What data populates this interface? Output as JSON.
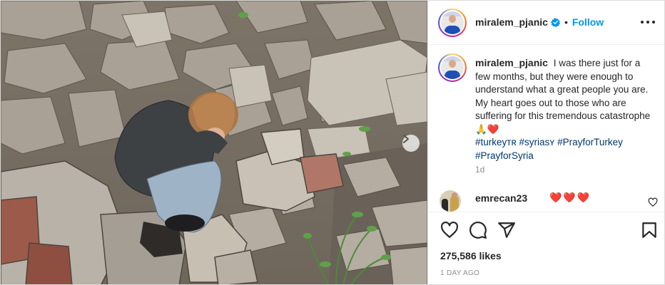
{
  "post": {
    "image_alt": "Child sitting in rubble covering his face",
    "next_icon": "chevron-right-icon"
  },
  "header": {
    "username": "miralem_pjanic",
    "separator": "•",
    "follow_label": "Follow",
    "more_icon": "more-horizontal-icon",
    "verified_icon": "verified-badge-icon",
    "verified_color": "#0095f6"
  },
  "caption": {
    "username": "miralem_pjanic",
    "text": "I was there just for a few months, but they were enough to understand what a great people you are. My heart goes out to those who are suffering for this tremendous catastrophe 🙏❤️",
    "hashtags": [
      "#turkeyᴛʀ",
      "#syriasʏ",
      "#PrayforTurkey",
      "#PrayforSyria"
    ],
    "time": "1d",
    "hashtag_color": "#00376b"
  },
  "comment": {
    "username": "emrecan23",
    "text": "❤️❤️❤️",
    "like_icon": "heart-outline-icon"
  },
  "actions": {
    "like_icon": "heart-outline-icon",
    "comment_icon": "comment-icon",
    "share_icon": "paper-plane-icon",
    "save_icon": "bookmark-icon",
    "likes": "275,586 likes",
    "posted": "1 DAY AGO"
  },
  "colors": {
    "accent": "#0095f6",
    "text": "#262626",
    "muted": "#8e8e8e",
    "heart": "#e0245e"
  }
}
